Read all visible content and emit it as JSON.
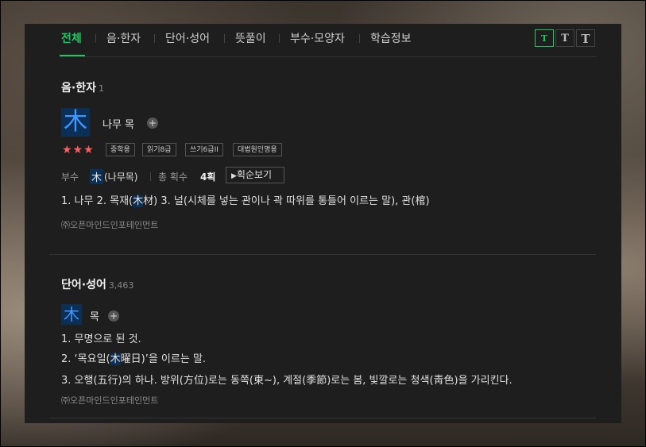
{
  "tabs": [
    "전체",
    "음·한자",
    "단어·성어",
    "뜻풀이",
    "부수·모양자",
    "학습정보"
  ],
  "font_size_buttons": [
    "T",
    "T",
    "T"
  ],
  "colors": {
    "accent": "#1ec760",
    "hanja_bg": "#0c2f55",
    "hanja_fg": "#3f96ff",
    "star": "#ff5f5f"
  },
  "hanja_section": {
    "title": "음·한자",
    "count": "1",
    "character": "木",
    "reading": "나무 목",
    "plus_icon": "+",
    "stars": "★★★",
    "tags": [
      "중학용",
      "읽기8급",
      "쓰기6급II",
      "대법원인명용"
    ],
    "radical_label": "부수",
    "radical_char": "木",
    "radical_name": "(나무목)",
    "strokes_label": "총 획수",
    "strokes_value": "4획",
    "stroke_order_button": "획순보기",
    "definition_parts": [
      "1. 나무  2. 목재(",
      "木",
      "材)  3. 널(시체를 넣는 관이나 곽 따위를 통틀어 이르는 말), 관(棺)"
    ],
    "source": "㈜오픈마인드인포테인먼트"
  },
  "word_section": {
    "title": "단어·성어",
    "count": "3,463",
    "character": "木",
    "reading": "목",
    "plus_icon": "+",
    "def1": "1. 무명으로 된 것.",
    "def2_parts": [
      "2. ‘목요일(",
      "木",
      "曜日)’을 이르는 말."
    ],
    "def3": "3. 오행(五行)의 하나. 방위(方位)로는 동쪽(東~), 계절(季節)로는 봄, 빛깔로는 청색(靑色)을 가리킨다.",
    "source": "㈜오픈마인드인포테인먼트"
  }
}
